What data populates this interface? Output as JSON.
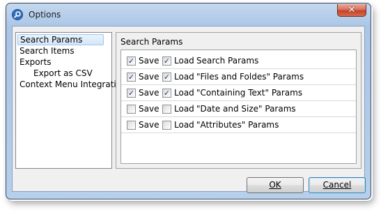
{
  "window": {
    "title": "Options",
    "close_glyph": "✕"
  },
  "tree": {
    "items": [
      {
        "label": "Search Params",
        "selected": true
      },
      {
        "label": "Search Items"
      },
      {
        "label": "Exports"
      },
      {
        "label": "Export as CSV"
      },
      {
        "label": "Context Menu Integration"
      }
    ]
  },
  "panel": {
    "title": "Search Params",
    "rows": [
      {
        "save_label": "Save",
        "save_checked": true,
        "load_label": "Load",
        "load_checked": true,
        "name": "Search Params"
      },
      {
        "save_label": "Save",
        "save_checked": true,
        "load_label": "Load",
        "load_checked": true,
        "name": "\"Files and Foldes\" Params"
      },
      {
        "save_label": "Save",
        "save_checked": true,
        "load_label": "Load",
        "load_checked": true,
        "name": "\"Containing Text\" Params"
      },
      {
        "save_label": "Save",
        "save_checked": false,
        "load_label": "Load",
        "load_checked": false,
        "name": "\"Date and Size\" Params"
      },
      {
        "save_label": "Save",
        "save_checked": false,
        "load_label": "Load",
        "load_checked": false,
        "name": "\"Attributes\" Params"
      }
    ]
  },
  "buttons": {
    "ok": "OK",
    "cancel": "Cancel"
  },
  "icons": {
    "check": "✓",
    "app": "search-icon"
  }
}
